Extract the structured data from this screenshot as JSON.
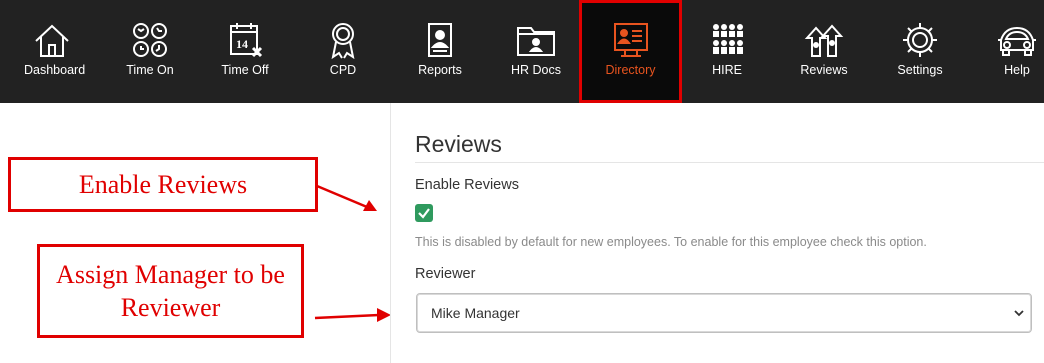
{
  "nav": {
    "items": [
      {
        "label": "Dashboard",
        "icon": "home-icon"
      },
      {
        "label": "Time On",
        "icon": "clocks-icon"
      },
      {
        "label": "Time Off",
        "icon": "calendar-icon"
      },
      {
        "label": "CPD",
        "icon": "award-ribbon-icon"
      },
      {
        "label": "Reports",
        "icon": "report-document-icon"
      },
      {
        "label": "HR Docs",
        "icon": "folder-person-icon"
      },
      {
        "label": "Directory",
        "icon": "directory-icon"
      },
      {
        "label": "HIRE",
        "icon": "people-grid-icon"
      },
      {
        "label": "Reviews",
        "icon": "reviews-arrows-icon"
      },
      {
        "label": "Settings",
        "icon": "gear-icon"
      },
      {
        "label": "Help",
        "icon": "car-icon"
      }
    ],
    "active": "Directory"
  },
  "callouts": {
    "enable": "Enable Reviews",
    "assign": "Assign Manager to be Reviewer"
  },
  "reviews": {
    "title": "Reviews",
    "enable_label": "Enable Reviews",
    "enable_checked": true,
    "help_text": "This is disabled by default for new employees. To enable for this employee check this option.",
    "reviewer_label": "Reviewer",
    "reviewer_value": "Mike Manager"
  },
  "colors": {
    "navbar": "#222222",
    "accent_red": "#e00000",
    "active_orange": "#e8541f",
    "checkbox_green": "#2f9a5e"
  }
}
